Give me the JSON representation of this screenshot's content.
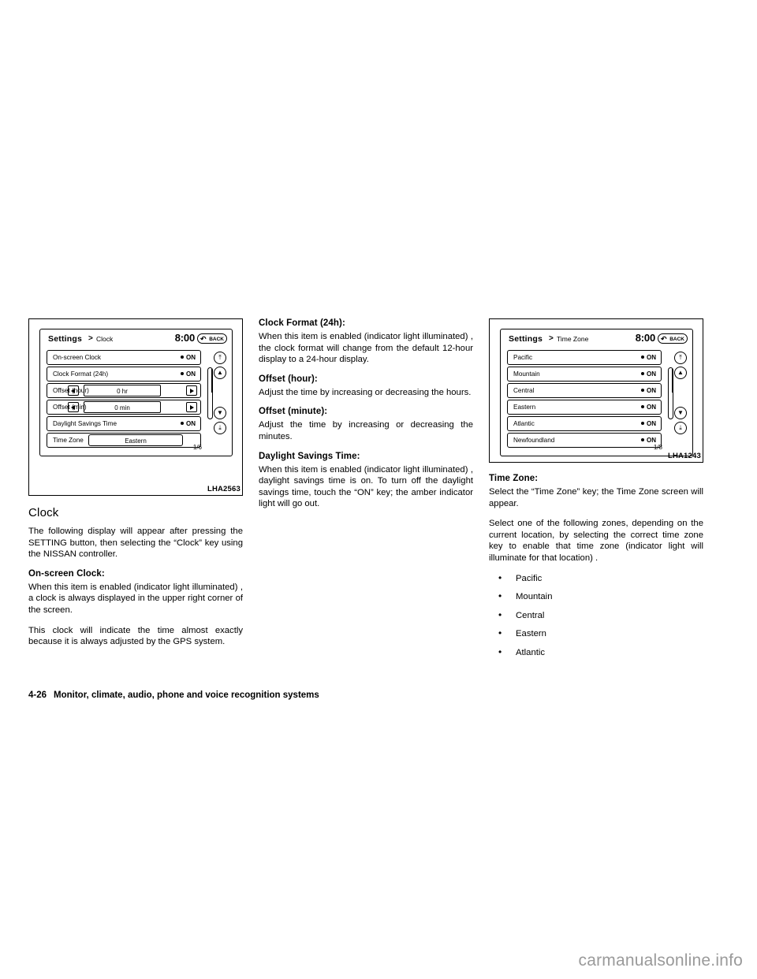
{
  "figure1": {
    "caption": "LHA2563",
    "screen": {
      "title": "Settings",
      "gt": ">",
      "subtitle": "Clock",
      "clock": "8:00",
      "back_label": "BACK",
      "back_icon": "back-arrow-icon",
      "page_count": "1/6",
      "rows": [
        {
          "label": "On-screen Clock",
          "state": "ON"
        },
        {
          "label": "Clock Format (24h)",
          "state": "ON"
        },
        {
          "label": "Offset (hour)",
          "value": "0 hr",
          "stepper": true
        },
        {
          "label": "Offset (min)",
          "value": "0 min",
          "stepper": true
        },
        {
          "label": "Daylight Savings Time",
          "state": "ON"
        },
        {
          "label": "Time Zone",
          "value": "Eastern"
        }
      ],
      "side_keys": [
        {
          "icon": "up-arrow-page-icon",
          "glyph": "⤒"
        },
        {
          "icon": "up-arrow-icon",
          "glyph": "▲"
        },
        {
          "icon": "down-arrow-icon",
          "glyph": "▼"
        },
        {
          "icon": "down-arrow-page-icon",
          "glyph": "⤓"
        }
      ]
    }
  },
  "figure3": {
    "caption": "LHA1243",
    "screen": {
      "title": "Settings",
      "gt": ">",
      "subtitle": "Time Zone",
      "clock": "8:00",
      "back_label": "BACK",
      "back_icon": "back-arrow-icon",
      "page_count": "1/8",
      "rows": [
        {
          "label": "Pacific",
          "state": "ON"
        },
        {
          "label": "Mountain",
          "state": "ON"
        },
        {
          "label": "Central",
          "state": "ON"
        },
        {
          "label": "Eastern",
          "state": "ON"
        },
        {
          "label": "Atlantic",
          "state": "ON"
        },
        {
          "label": "Newfoundland",
          "state": "ON"
        }
      ],
      "side_keys": [
        {
          "icon": "up-arrow-page-icon",
          "glyph": "⤒"
        },
        {
          "icon": "up-arrow-icon",
          "glyph": "▲"
        },
        {
          "icon": "down-arrow-icon",
          "glyph": "▼"
        },
        {
          "icon": "down-arrow-page-icon",
          "glyph": "⤓"
        }
      ]
    }
  },
  "column1": {
    "heading": "Clock",
    "intro": "The following display will appear after pressing the SETTING button, then selecting the “Clock” key using the NISSAN controller.",
    "onscreen_clock_heading": "On-screen Clock:",
    "onscreen_clock_p1": "When this item is enabled (indicator light illuminated) , a clock is always displayed in the upper right corner of the screen.",
    "onscreen_clock_p2": "This clock will indicate the time almost exactly because it is always adjusted by the GPS system."
  },
  "column2": {
    "clock_format_heading": "Clock Format (24h):",
    "clock_format_body": "When this item is enabled (indicator light illuminated) , the clock format will change from the default 12-hour display to a 24-hour display.",
    "offset_hour_heading": "Offset (hour):",
    "offset_hour_body": "Adjust the time by increasing or decreasing the hours.",
    "offset_min_heading": "Offset (minute):",
    "offset_min_body": "Adjust the time by increasing or decreasing the minutes.",
    "dst_heading": "Daylight Savings Time:",
    "dst_body": "When this item is enabled (indicator light illuminated) , daylight savings time is on. To turn off the daylight savings time, touch the “ON” key; the amber indicator light will go out."
  },
  "column3": {
    "time_zone_heading": "Time Zone:",
    "time_zone_p1": "Select the “Time Zone” key; the Time Zone screen will appear.",
    "time_zone_p2": "Select one of the following zones, depending on the current location, by selecting the correct time zone key to enable that time zone (indicator light will illuminate for that location) .",
    "zones": [
      "Pacific",
      "Mountain",
      "Central",
      "Eastern",
      "Atlantic"
    ]
  },
  "footer": {
    "page_number": "4-26",
    "chapter_title": "Monitor, climate, audio, phone and voice recognition systems"
  },
  "watermark": {
    "text": "carmanualsonline.info"
  }
}
